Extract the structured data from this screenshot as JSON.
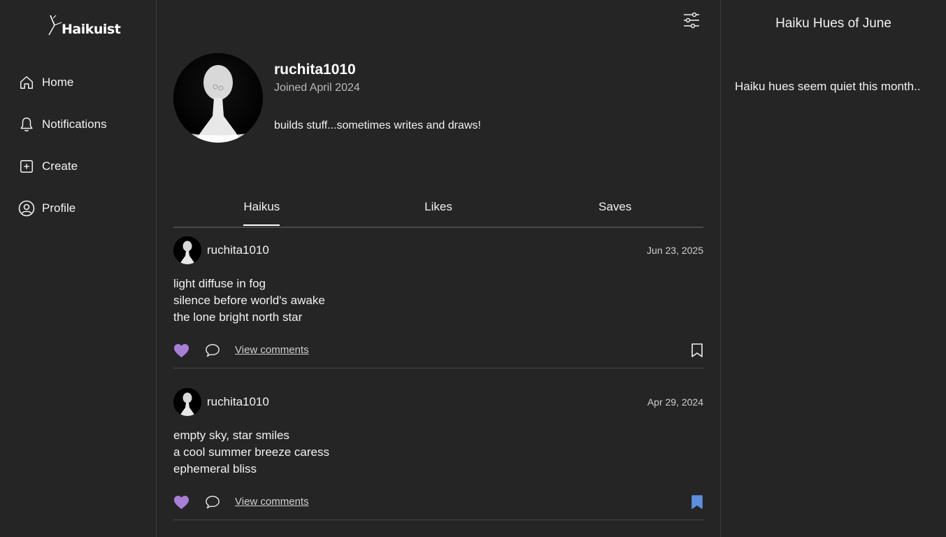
{
  "brand": {
    "name": "Haikuist"
  },
  "nav": {
    "items": [
      {
        "label": "Home",
        "icon": "home-icon"
      },
      {
        "label": "Notifications",
        "icon": "bell-icon"
      },
      {
        "label": "Create",
        "icon": "plus-square-icon"
      },
      {
        "label": "Profile",
        "icon": "user-circle-icon"
      }
    ]
  },
  "profile": {
    "username": "ruchita1010",
    "joined": "Joined April 2024",
    "bio": "builds stuff...sometimes writes and draws!"
  },
  "tabs": [
    {
      "label": "Haikus",
      "active": true
    },
    {
      "label": "Likes",
      "active": false
    },
    {
      "label": "Saves",
      "active": false
    }
  ],
  "posts": [
    {
      "user": "ruchita1010",
      "date": "Jun 23, 2025",
      "lines": [
        "light diffuse in fog",
        "silence before world's awake",
        "the lone bright north star"
      ],
      "liked": true,
      "saved": false,
      "comments_label": "View comments"
    },
    {
      "user": "ruchita1010",
      "date": "Apr 29, 2024",
      "lines": [
        "empty sky, star smiles",
        "a cool summer breeze caress",
        "ephemeral bliss"
      ],
      "liked": true,
      "saved": true,
      "comments_label": "View comments"
    }
  ],
  "sidepanel": {
    "title": "Haiku Hues of June",
    "message": "Haiku hues seem quiet this month.."
  },
  "colors": {
    "background": "#252525",
    "like": "#a77fd6",
    "saved": "#5b8fe0"
  }
}
